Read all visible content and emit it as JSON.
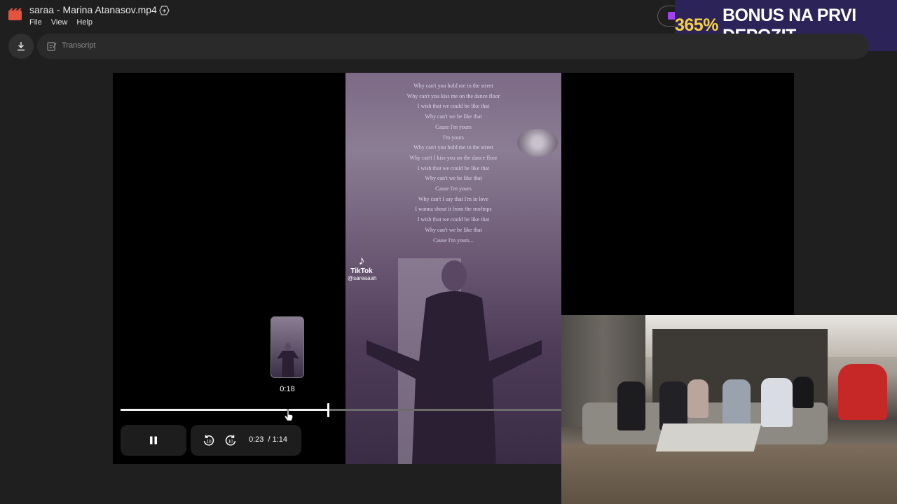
{
  "window": {
    "file_title": "saraa - Marina Atanasov.mp4",
    "menu": [
      "File",
      "View",
      "Help"
    ]
  },
  "toolbar": {
    "transcript_label": "Transcript"
  },
  "ad_banner": {
    "highlight": "365%",
    "text": "BONUS NA PRVI DEPOZIT"
  },
  "video": {
    "lyrics": [
      "Why can't you hold me in the street",
      "Why can't you kiss me on the dance floor",
      "I wish that we could be like that",
      "Why can't we be like that",
      "Cause I'm yours",
      "I'm yours",
      "Why can't you hold me in the street",
      "Why can't I kiss you on the dance floor",
      "I wish that we could be like that",
      "Why can't we be like that",
      "Cause I'm yours",
      "Why can't I say that I'm in love",
      "I wanna shout it from the rooftops",
      "I wish that we could be like that",
      "Why can't we be like that",
      "Cause I'm yours..."
    ],
    "watermark_name": "TikTok",
    "watermark_handle": "@sareaaah"
  },
  "player": {
    "preview_time": "0:18",
    "current_time": "0:23",
    "duration": "/ 1:14",
    "progress_fraction": 0.311
  }
}
